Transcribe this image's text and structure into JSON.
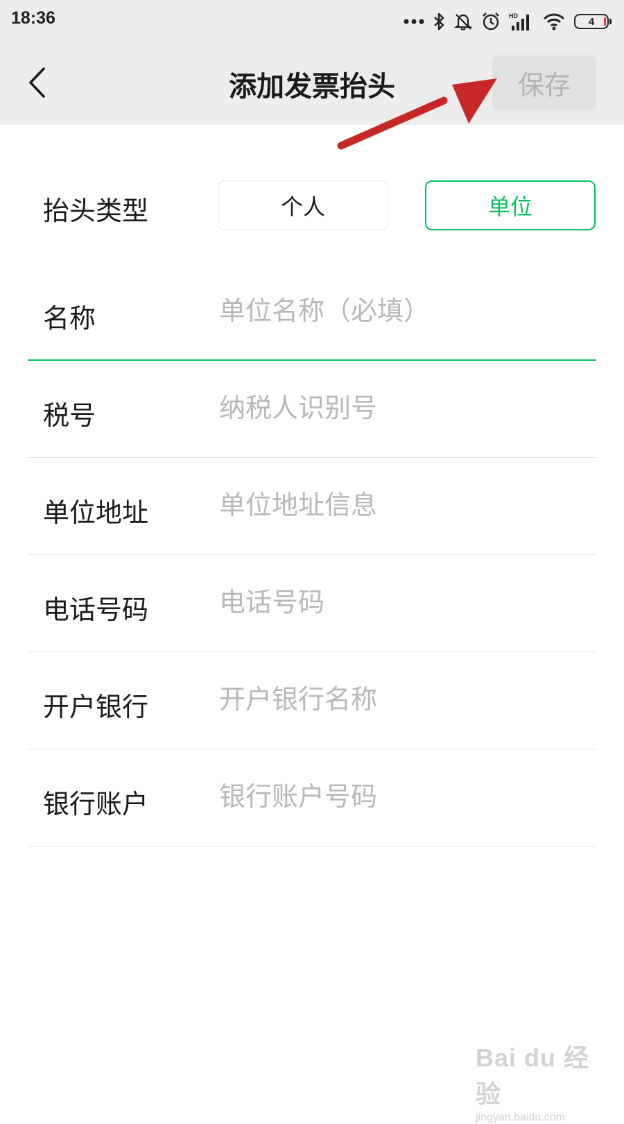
{
  "status_bar": {
    "time": "18:36",
    "battery_level": "4",
    "icons": [
      "more-dots-icon",
      "bluetooth-icon",
      "mute-bell-icon",
      "alarm-icon",
      "hd-signal-icon",
      "wifi-icon",
      "battery-icon"
    ]
  },
  "header": {
    "title": "添加发票抬头",
    "save_label": "保存",
    "back_icon": "chevron-left-icon"
  },
  "invoice_type": {
    "label": "抬头类型",
    "options": [
      {
        "label": "个人",
        "selected": false
      },
      {
        "label": "单位",
        "selected": true
      }
    ]
  },
  "fields": [
    {
      "label": "名称",
      "placeholder": "单位名称（必填）",
      "value": ""
    },
    {
      "label": "税号",
      "placeholder": "纳税人识别号",
      "value": ""
    },
    {
      "label": "单位地址",
      "placeholder": "单位地址信息",
      "value": ""
    },
    {
      "label": "电话号码",
      "placeholder": "电话号码",
      "value": ""
    },
    {
      "label": "开户银行",
      "placeholder": "开户银行名称",
      "value": ""
    },
    {
      "label": "银行账户",
      "placeholder": "银行账户号码",
      "value": ""
    }
  ],
  "watermark": {
    "text": "Bai du 经验",
    "sub": "jingyan.baidu.com"
  },
  "colors": {
    "accent": "#07c160",
    "header_bg": "#ededed",
    "annotation_arrow": "#c62828",
    "placeholder": "#b8b8b8"
  }
}
